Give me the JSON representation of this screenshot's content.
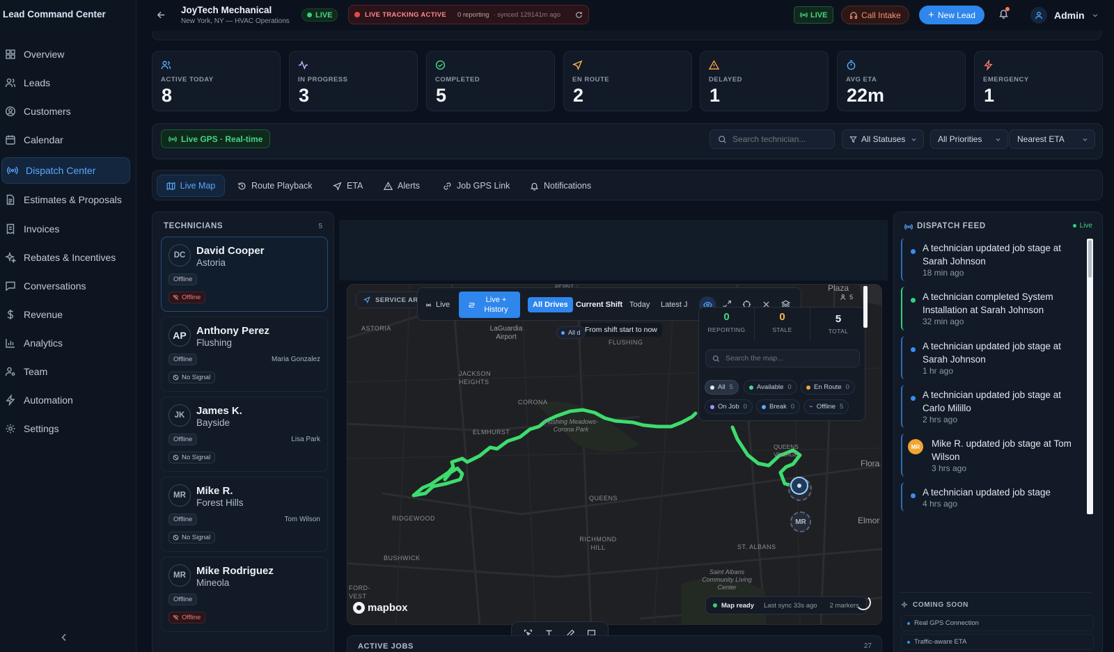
{
  "sidebar": {
    "brand": "Lead Command Center",
    "items": [
      {
        "label": "Overview"
      },
      {
        "label": "Leads"
      },
      {
        "label": "Customers"
      },
      {
        "label": "Calendar"
      },
      {
        "label": "Dispatch Center"
      },
      {
        "label": "Estimates & Proposals"
      },
      {
        "label": "Invoices"
      },
      {
        "label": "Rebates & Incentives"
      },
      {
        "label": "Conversations"
      },
      {
        "label": "Revenue"
      },
      {
        "label": "Analytics"
      },
      {
        "label": "Team"
      },
      {
        "label": "Automation"
      },
      {
        "label": "Settings"
      }
    ],
    "active_item": "Dispatch Center"
  },
  "header": {
    "company": "JoyTech Mechanical",
    "subtitle": "New York, NY — HVAC Operations",
    "live_badge": "LIVE",
    "tracking_label": "LIVE TRACKING ACTIVE",
    "reporting": "0 reporting",
    "synced": "· synced 129141m ago",
    "live_right": "LIVE",
    "call_intake": "Call Intake",
    "new_lead": "New Lead",
    "user": "Admin"
  },
  "stats": [
    {
      "label": "ACTIVE TODAY",
      "value": "8",
      "color": "#5aa9ff",
      "icon": "users-icon"
    },
    {
      "label": "IN PROGRESS",
      "value": "3",
      "color": "#c9b4ff",
      "icon": "activity-icon"
    },
    {
      "label": "COMPLETED",
      "value": "5",
      "color": "#4cd78c",
      "icon": "check-circle-icon"
    },
    {
      "label": "EN ROUTE",
      "value": "2",
      "color": "#f5b94c",
      "icon": "navigation-icon"
    },
    {
      "label": "DELAYED",
      "value": "1",
      "color": "#f5a04c",
      "icon": "alert-triangle-icon"
    },
    {
      "label": "AVG ETA",
      "value": "22m",
      "color": "#5aa9ff",
      "icon": "timer-icon"
    },
    {
      "label": "EMERGENCY",
      "value": "1",
      "color": "#ff7a6b",
      "icon": "zap-icon"
    }
  ],
  "filters": {
    "gps_label": "Live GPS · Real-time",
    "search_placeholder": "Search technician...",
    "status": "All Statuses",
    "priority": "All Priorities",
    "sort": "Nearest ETA"
  },
  "tabs": [
    {
      "label": "Live Map",
      "icon": "map-icon"
    },
    {
      "label": "Route Playback",
      "icon": "history-icon"
    },
    {
      "label": "ETA",
      "icon": "navigation-icon"
    },
    {
      "label": "Alerts",
      "icon": "alert-triangle-icon"
    },
    {
      "label": "Job GPS Link",
      "icon": "link-icon"
    },
    {
      "label": "Notifications",
      "icon": "bell-icon"
    }
  ],
  "technicians": {
    "title": "TECHNICIANS",
    "count": "5",
    "list": [
      {
        "initials": "DC",
        "name": "David Cooper",
        "location": "Astoria",
        "status": "Offline",
        "signal": "Offline",
        "assigned": ""
      },
      {
        "initials": "AP",
        "name": "Anthony Perez",
        "location": "Flushing",
        "status": "Offline",
        "signal": "No Signal",
        "assigned": "Maria Gonzalez"
      },
      {
        "initials": "JK",
        "name": "James K.",
        "location": "Bayside",
        "status": "Offline",
        "signal": "No Signal",
        "assigned": "Lisa Park"
      },
      {
        "initials": "MR",
        "name": "Mike R.",
        "location": "Forest Hills",
        "status": "Offline",
        "signal": "No Signal",
        "assigned": "Tom Wilson"
      },
      {
        "initials": "MR",
        "name": "Mike Rodriguez",
        "location": "Mineola",
        "status": "Offline",
        "signal": "Offline",
        "assigned": ""
      }
    ]
  },
  "map": {
    "service_area": "SERVICE AR",
    "mode_live": "Live",
    "mode_history": "Live + History",
    "filter_all": "All Drives",
    "filter_shift": "Current Shift",
    "filter_today": "Today",
    "filter_latest": "Latest J",
    "tooltip": "From shift start to now",
    "all_drivers_chip": "All d",
    "team_count": "5",
    "counts": [
      {
        "label": "REPORTING",
        "value": "0"
      },
      {
        "label": "STALE",
        "value": "0"
      },
      {
        "label": "TOTAL",
        "value": "5"
      }
    ],
    "search_placeholder": "Search the map...",
    "chips": [
      {
        "label": "All",
        "count": "5",
        "color": "#e6ebf2"
      },
      {
        "label": "Available",
        "count": "0",
        "color": "#4cd78c"
      },
      {
        "label": "En Route",
        "count": "0",
        "color": "#f5a04c"
      },
      {
        "label": "On Job",
        "count": "0",
        "color": "#a98bff"
      },
      {
        "label": "Break",
        "count": "0",
        "color": "#5aa9ff"
      },
      {
        "label": "Offline",
        "count": "5",
        "color": "#8893a3"
      }
    ],
    "places": [
      "POINT",
      "Plaza",
      "ASTORIA",
      "LaGuardia Airport",
      "JACKSON HEIGHTS",
      "CORONA",
      "Flushing Meadows-Corona Park",
      "ELMHURST",
      "FLUSHING",
      "QUEENS VILLAGE",
      "Flora",
      "RIDGEWOOD",
      "QUEENS",
      "Elmor",
      "RICHMOND HILL",
      "ST. ALBANS",
      "BUSHWICK",
      "Saint Albans Community Living Center",
      "FORD-VEST"
    ],
    "markers": [
      "DC",
      "MR"
    ],
    "status_ready": "Map ready",
    "status_sync": "Last sync 33s ago",
    "status_markers": "2 markers",
    "attribution": "mapbox"
  },
  "active_jobs": {
    "title": "ACTIVE JOBS",
    "count": "27"
  },
  "feed": {
    "title": "DISPATCH FEED",
    "live": "Live",
    "items": [
      {
        "text": "A technician updated job stage at Sarah Johnson",
        "time": "18 min ago",
        "avatar": ""
      },
      {
        "text": "A technician completed System Installation at Sarah Johnson",
        "time": "32 min ago",
        "avatar": ""
      },
      {
        "text": "A technician updated job stage at Sarah Johnson",
        "time": "1 hr ago",
        "avatar": ""
      },
      {
        "text": "A technician updated job stage at Carlo Milillo",
        "time": "2 hrs ago",
        "avatar": ""
      },
      {
        "text": "Mike R. updated job stage at Tom Wilson",
        "time": "3 hrs ago",
        "avatar": "MR"
      },
      {
        "text": "A technician updated job stage",
        "time": "4 hrs ago",
        "avatar": ""
      }
    ]
  },
  "coming_soon": {
    "title": "COMING SOON",
    "items": [
      "Real GPS Connection",
      "Traffic-aware ETA"
    ]
  },
  "colors": {
    "accent": "#2f86ec",
    "live_green": "#33d17a",
    "route": "#3ddc6e",
    "danger": "#e5484d"
  }
}
